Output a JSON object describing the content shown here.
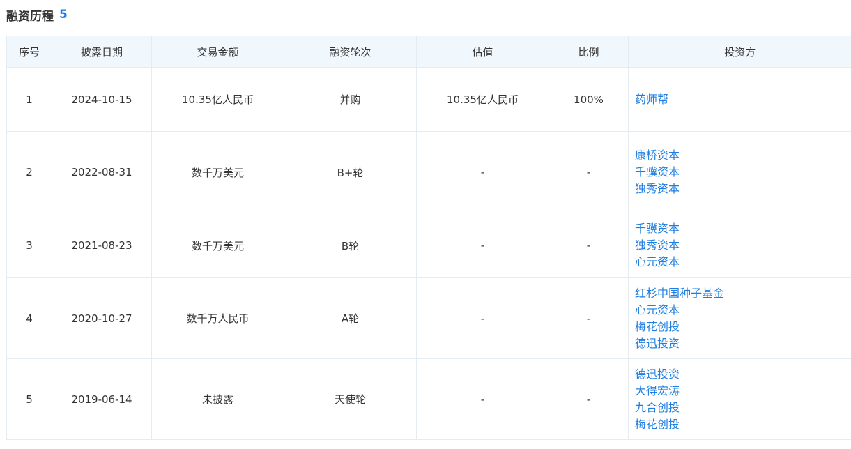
{
  "section": {
    "title": "融资历程",
    "count": "5"
  },
  "columns": [
    "序号",
    "披露日期",
    "交易金额",
    "融资轮次",
    "估值",
    "比例",
    "投资方"
  ],
  "rows": [
    {
      "index": "1",
      "date": "2024-10-15",
      "amount": "10.35亿人民币",
      "round": "并购",
      "valuation": "10.35亿人民币",
      "ratio": "100%",
      "investors": [
        "药师帮"
      ]
    },
    {
      "index": "2",
      "date": "2022-08-31",
      "amount": "数千万美元",
      "round": "B+轮",
      "valuation": "-",
      "ratio": "-",
      "investors": [
        "康桥资本",
        "千骥资本",
        "独秀资本"
      ]
    },
    {
      "index": "3",
      "date": "2021-08-23",
      "amount": "数千万美元",
      "round": "B轮",
      "valuation": "-",
      "ratio": "-",
      "investors": [
        "千骥资本",
        "独秀资本",
        "心元资本"
      ]
    },
    {
      "index": "4",
      "date": "2020-10-27",
      "amount": "数千万人民币",
      "round": "A轮",
      "valuation": "-",
      "ratio": "-",
      "investors": [
        "红杉中国种子基金",
        "心元资本",
        "梅花创投",
        "德迅投资"
      ]
    },
    {
      "index": "5",
      "date": "2019-06-14",
      "amount": "未披露",
      "round": "天使轮",
      "valuation": "-",
      "ratio": "-",
      "investors": [
        "德迅投资",
        "大得宏涛",
        "九合创投",
        "梅花创投"
      ]
    }
  ],
  "colors": {
    "accent": "#1e7ee0",
    "header_bg": "#f0f7fd",
    "border": "#e4ebf1"
  }
}
